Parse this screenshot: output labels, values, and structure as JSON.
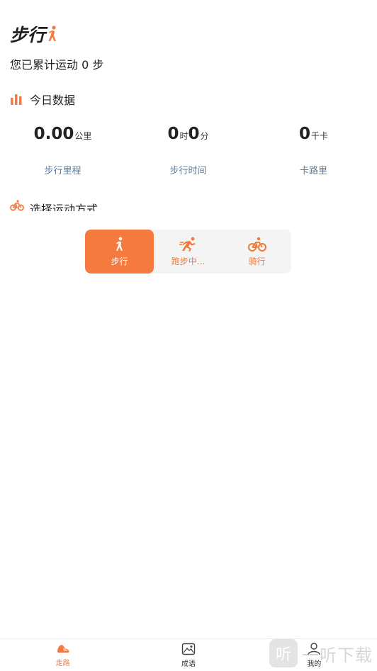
{
  "header": {
    "title": "步行",
    "title_icon": "walking-person-icon",
    "accent": "#f47a40"
  },
  "summary": {
    "text": "您已累计运动 0 步"
  },
  "today": {
    "heading": "今日数据",
    "stats": [
      {
        "value": "0.00",
        "unit": "公里",
        "label": "步行里程"
      },
      {
        "value_h": "0",
        "unit_h": "时",
        "value_m": "0",
        "unit_m": "分",
        "label": "步行时间"
      },
      {
        "value": "0",
        "unit": "千卡",
        "label": "卡路里"
      }
    ]
  },
  "modes": {
    "heading": "选择运动方式",
    "items": [
      {
        "label": "步行",
        "icon": "walk-icon",
        "active": true
      },
      {
        "label": "跑步中...",
        "icon": "run-icon",
        "active": false
      },
      {
        "label": "骑行",
        "icon": "bike-icon",
        "active": false
      }
    ]
  },
  "tabbar": {
    "items": [
      {
        "label": "走路",
        "icon": "shoe-icon",
        "active": true
      },
      {
        "label": "成语",
        "icon": "image-icon",
        "active": false
      },
      {
        "label": "我的",
        "icon": "user-icon",
        "active": false
      }
    ]
  },
  "watermark": {
    "glyph": "听",
    "text": "一听下载"
  }
}
